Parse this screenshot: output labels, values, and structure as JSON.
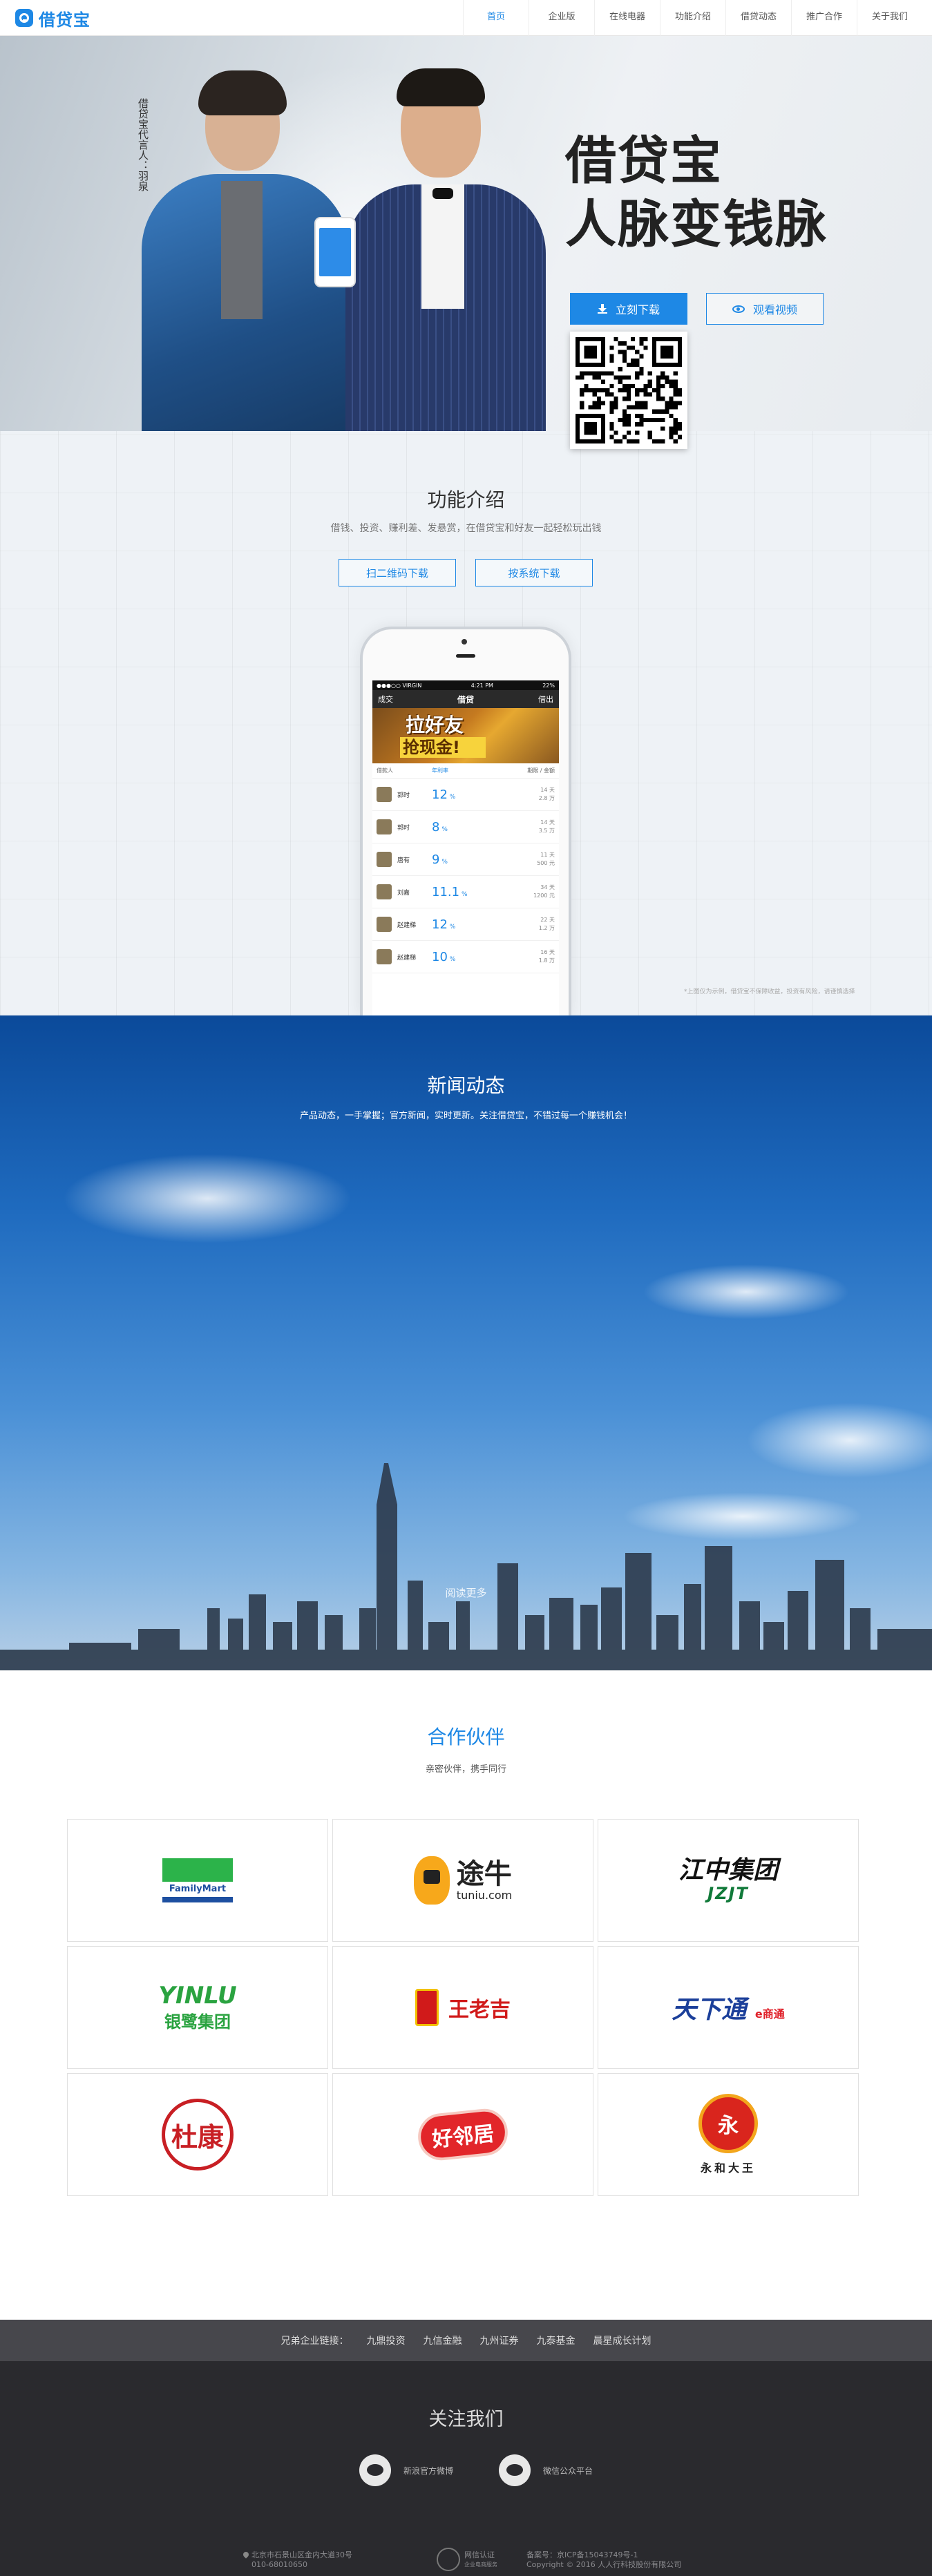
{
  "header": {
    "logo_text": "借贷宝",
    "nav": [
      "首页",
      "企业版",
      "在线电器",
      "功能介绍",
      "借贷动态",
      "推广合作",
      "关于我们"
    ]
  },
  "hero": {
    "endorsement": "借贷宝代言人：羽泉",
    "title_line1": "借贷宝",
    "title_line2": "人脉变钱脉",
    "download_label": "立刻下载",
    "video_label": "观看视频"
  },
  "features": {
    "title": "功能介绍",
    "subtitle": "借钱、投资、赚利差、发悬赏，在借贷宝和好友一起轻松玩出钱",
    "qr_button": "扫二维码下载",
    "system_button": "按系统下载",
    "footnote": "*上图仅为示例，借贷宝不保障收益，投资有风险，请谨慎选择"
  },
  "app_screen": {
    "status_left": "●●●○○ VIRGIN",
    "status_time": "4:21 PM",
    "status_right": "22%",
    "back": "成交",
    "title": "借贷",
    "action": "借出",
    "banner_line1": "拉好友",
    "banner_line2": "抢现金!",
    "col_name": "借款人",
    "col_rate": "年利率",
    "col_meta": "期限 / 金额",
    "rows": [
      {
        "name": "郭时",
        "rate": "12",
        "term": "14 天",
        "amount": "2.8 万"
      },
      {
        "name": "郭时",
        "rate": "8",
        "term": "14 天",
        "amount": "3.5 万"
      },
      {
        "name": "唐有",
        "rate": "9",
        "term": "11 天",
        "amount": "500 元"
      },
      {
        "name": "刘嘉",
        "rate": "11.1",
        "term": "34 天",
        "amount": "1200 元"
      },
      {
        "name": "赵建梯",
        "rate": "12",
        "term": "22 天",
        "amount": "1.2 万"
      },
      {
        "name": "赵建梯",
        "rate": "10",
        "term": "16 天",
        "amount": "1.8 万"
      }
    ]
  },
  "news": {
    "title": "新闻动态",
    "subtitle": "产品动态，一手掌握；官方新闻，实时更新。关注借贷宝，不错过每一个赚钱机会！",
    "read_more": "阅读更多"
  },
  "partners": {
    "title": "合作伙伴",
    "subtitle": "亲密伙伴，携手同行",
    "logos": {
      "familymart": "FamilyMart",
      "tuniu_cn": "途牛",
      "tuniu_en": "tuniu.com",
      "jz_cn": "江中集团",
      "jz_en": "JZJT",
      "yinlu_en": "YINLU",
      "yinlu_cn": "银鹭集团",
      "wanglaoji": "王老吉",
      "tianxiatong": "天下通",
      "tianxiatong_sub": "e商通",
      "dukang": "杜康",
      "haolinju": "好邻居",
      "yonghe_mark": "永",
      "yonghe": "永和大王"
    }
  },
  "links": {
    "label": "兄弟企业链接：",
    "items": [
      "九鼎投资",
      "九信金融",
      "九州证券",
      "九泰基金",
      "晨星成长计划"
    ]
  },
  "footer": {
    "title": "关注我们",
    "weibo": "新浪官方微博",
    "wechat": "微信公众平台",
    "address": "北京市石景山区金内大道30号",
    "phone": "010-68010650",
    "badge_label": "网信认证",
    "badge_sub": "企业电商服务",
    "icp": "京ICP备15043749号-1",
    "icp_prefix": "备案号：",
    "copyright": "Copyright © 2016 人人行科技股份有限公司"
  },
  "colors": {
    "accent": "#1e88e5",
    "footer_bg": "#2a2a2e",
    "links_bg": "#47474c"
  }
}
